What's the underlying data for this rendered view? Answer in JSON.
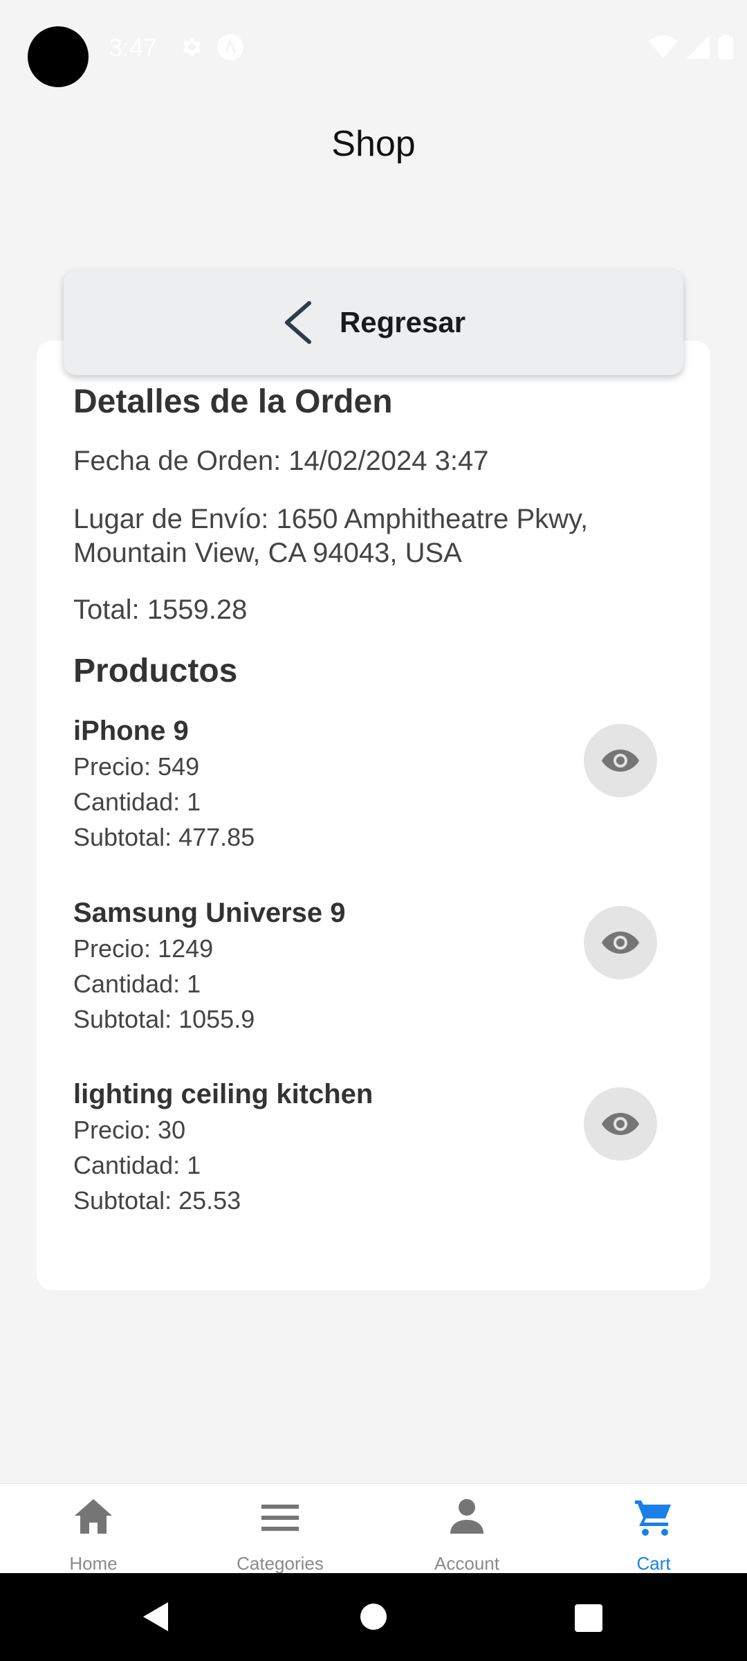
{
  "status_bar": {
    "time": "3:47"
  },
  "app": {
    "title": "Shop"
  },
  "back_button": {
    "label": "Regresar"
  },
  "order": {
    "heading": "Detalles de la Orden",
    "date": "Fecha de Orden: 14/02/2024 3:47",
    "shipping_line1": "Lugar de Envío: 1650 Amphitheatre Pkwy,",
    "shipping_line2": "Mountain View, CA 94043, USA",
    "total": "Total: 1559.28"
  },
  "products_heading": "Productos",
  "products": [
    {
      "name": "iPhone 9",
      "price": "Precio: 549",
      "quantity": "Cantidad: 1",
      "subtotal": "Subtotal: 477.85"
    },
    {
      "name": "Samsung Universe 9",
      "price": "Precio: 1249",
      "quantity": "Cantidad: 1",
      "subtotal": "Subtotal: 1055.9"
    },
    {
      "name": "lighting ceiling kitchen",
      "price": "Precio: 30",
      "quantity": "Cantidad: 1",
      "subtotal": "Subtotal: 25.53"
    }
  ],
  "bottom_nav": {
    "items": [
      {
        "label": "Home",
        "icon": "home-icon"
      },
      {
        "label": "Categories",
        "icon": "menu-icon"
      },
      {
        "label": "Account",
        "icon": "person-icon"
      },
      {
        "label": "Cart",
        "icon": "cart-icon",
        "active": true
      }
    ]
  },
  "colors": {
    "accent": "#1a7fe6",
    "background": "#f4f4f5",
    "card": "#ffffff",
    "eye_button": "#e4e4e4"
  }
}
